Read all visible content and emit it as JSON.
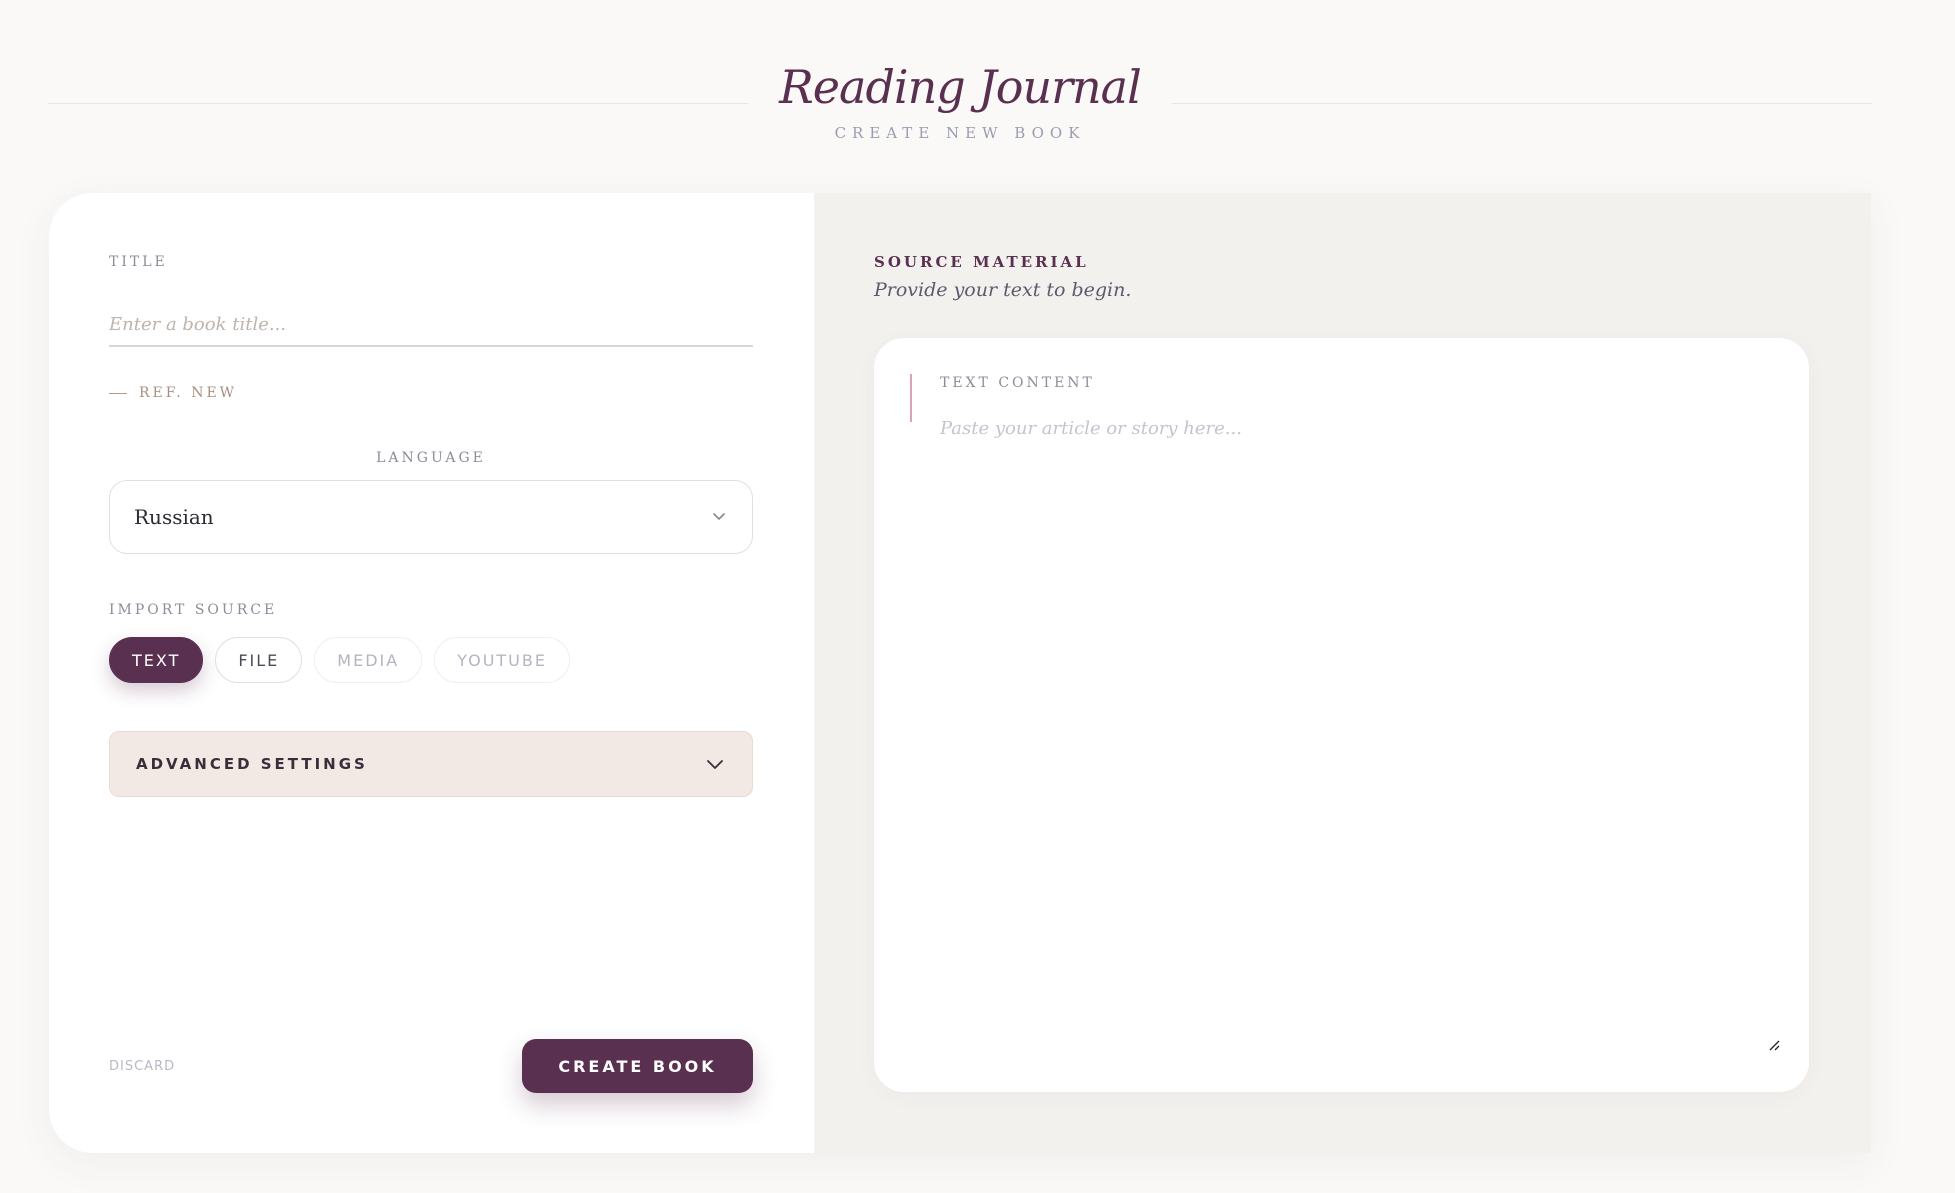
{
  "header": {
    "title": "Reading Journal",
    "subtitle": "CREATE NEW BOOK"
  },
  "form": {
    "title_label": "TITLE",
    "title_placeholder": "Enter a book title...",
    "title_value": "",
    "ref_text": "REF. NEW",
    "language_label": "LANGUAGE",
    "language_value": "Russian",
    "import_label": "IMPORT SOURCE",
    "import_options": [
      {
        "label": "TEXT",
        "state": "active"
      },
      {
        "label": "FILE",
        "state": "normal"
      },
      {
        "label": "MEDIA",
        "state": "muted"
      },
      {
        "label": "YOUTUBE",
        "state": "muted"
      }
    ],
    "advanced_label": "ADVANCED SETTINGS",
    "discard_label": "DISCARD",
    "create_label": "CREATE BOOK"
  },
  "source": {
    "heading": "SOURCE MATERIAL",
    "subheading": "Provide your text to begin.",
    "text_label": "TEXT CONTENT",
    "text_placeholder": "Paste your article or story here..."
  },
  "icons": {
    "language_chevron": "chevron-down-icon",
    "advanced_chevron": "chevron-down-icon",
    "resize": "resize-handle-icon"
  },
  "colors": {
    "accent": "#5a3050",
    "background": "#faf9f7",
    "panel": "#f3f1ee",
    "advanced_bg": "#f2e9e4"
  }
}
